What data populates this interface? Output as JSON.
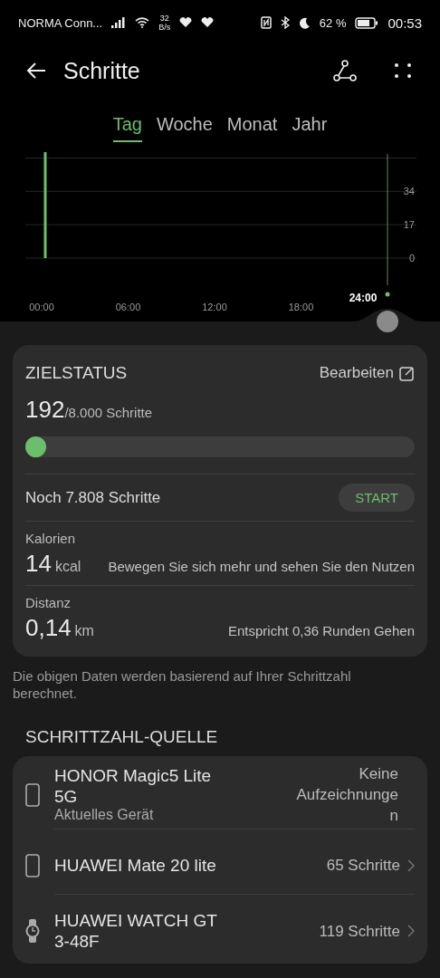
{
  "status_bar": {
    "carrier": "NORMA Conn...",
    "speed_value": "32",
    "speed_unit": "B/s",
    "battery": "62 %",
    "time": "00:53"
  },
  "header": {
    "title": "Schritte"
  },
  "tabs": [
    {
      "label": "Tag",
      "selected": true
    },
    {
      "label": "Woche",
      "selected": false
    },
    {
      "label": "Monat",
      "selected": false
    },
    {
      "label": "Jahr",
      "selected": false
    }
  ],
  "chart": {
    "cursor_label": "24:00",
    "chart_data": {
      "type": "bar",
      "x": [
        0.25
      ],
      "values": [
        54
      ],
      "xlim": [
        0,
        24
      ],
      "ylim": [
        0,
        54
      ],
      "yticks": [
        0,
        17,
        34
      ],
      "xticks": [
        {
          "value": 0,
          "label": "00:00"
        },
        {
          "value": 6,
          "label": "06:00"
        },
        {
          "value": 12,
          "label": "12:00"
        },
        {
          "value": 18,
          "label": "18:00"
        }
      ]
    }
  },
  "goal": {
    "title": "ZIELSTATUS",
    "edit": "Bearbeiten",
    "steps": "192",
    "target": "/8.000 Schritte",
    "level": 0.024,
    "remaining": "Noch 7.808 Schritte",
    "start": "START",
    "calories": {
      "label": "Kalorien",
      "value": "14",
      "unit": "kcal",
      "note": "Bewegen Sie sich mehr und sehen Sie den Nutzen"
    },
    "distance": {
      "label": "Distanz",
      "value": "0,14",
      "unit": "km",
      "note": "Entspricht 0,36 Runden Gehen"
    }
  },
  "footnote": "Die obigen Daten werden basierend auf Ihrer Schrittzahl berechnet.",
  "sources": {
    "title": "SCHRITTZAHL-QUELLE",
    "items": [
      {
        "kind": "phone",
        "name": "HONOR Magic5 Lite 5G",
        "subtitle": "Aktuelles Gerät",
        "value": "Keine Aufzeichnunge n",
        "chevron": false
      },
      {
        "kind": "phone",
        "name": "HUAWEI Mate 20 lite",
        "value": "65 Schritte",
        "chevron": true
      },
      {
        "kind": "watch",
        "name": "HUAWEI WATCH GT 3-48F",
        "value": "119 Schritte",
        "chevron": true
      }
    ]
  }
}
